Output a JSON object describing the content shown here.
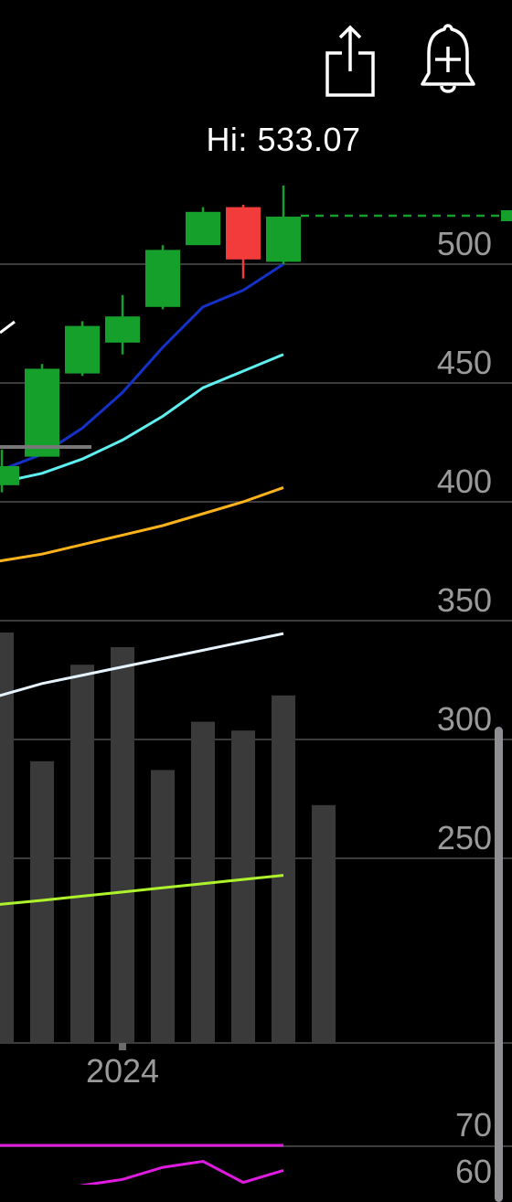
{
  "toolbar": {
    "share_icon": "share-icon",
    "alert_icon": "bell-plus-icon"
  },
  "hi_label": "Hi: 533.07",
  "colors": {
    "background": "#000000",
    "candle_up": "#14a02a",
    "candle_down": "#f23b3b",
    "ma_short": "#1431c8",
    "ma_mid": "#5ef0f0",
    "ma_long": "#ffb31a",
    "volume": "#3a3a3a",
    "volume_ma_fast": "#e6f4ff",
    "volume_ma_slow": "#aef22b",
    "rsi": "#e01be0",
    "grid": "#3c3c3c",
    "hi_marker": "#14a02a"
  },
  "chart_data": {
    "type": "candlestick",
    "y_axis": {
      "ticks": [
        "500",
        "450",
        "400",
        "350",
        "300",
        "250"
      ],
      "values": [
        500,
        450,
        400,
        350,
        300,
        250
      ],
      "range": [
        230,
        530
      ]
    },
    "x_axis": {
      "labels": [
        "2024"
      ],
      "label_index": [
        3
      ]
    },
    "candles": [
      {
        "open": 407,
        "close": 415,
        "high": 422,
        "low": 404
      },
      {
        "open": 419,
        "close": 456,
        "high": 458,
        "low": 419
      },
      {
        "open": 454,
        "close": 474,
        "high": 476,
        "low": 453
      },
      {
        "open": 467,
        "close": 478,
        "high": 487,
        "low": 462
      },
      {
        "open": 482,
        "close": 506,
        "high": 508,
        "low": 481
      },
      {
        "open": 508,
        "close": 522,
        "high": 524,
        "low": 518
      },
      {
        "open": 524,
        "close": 502,
        "high": 525,
        "low": 494
      },
      {
        "open": 501,
        "close": 520,
        "high": 533.07,
        "low": 500
      }
    ],
    "hi_value": 533.07,
    "ma_short": [
      413,
      420,
      431,
      446,
      465,
      482,
      489,
      500
    ],
    "ma_mid": [
      408,
      412,
      418,
      426,
      436,
      448,
      455,
      462
    ],
    "ma_long": [
      375,
      378,
      382,
      386,
      390,
      395,
      400,
      406
    ],
    "volume": [
      {
        "value": 0.64,
        "color": "dark"
      },
      {
        "value": 0.86,
        "color": "dark"
      },
      {
        "value": 0.9,
        "color": "dark"
      },
      {
        "value": 0.62,
        "color": "dark"
      },
      {
        "value": 0.73,
        "color": "dark"
      },
      {
        "value": 0.71,
        "color": "dark"
      },
      {
        "value": 0.79,
        "color": "dark"
      },
      {
        "value": 0.54,
        "color": "dark"
      }
    ],
    "volume_left_edge": 1.0,
    "volume_ma_fast": [
      0.83,
      0.86,
      0.88,
      0.9,
      0.92,
      0.94,
      0.96,
      0.98
    ],
    "volume_ma_slow": [
      0.33,
      0.34,
      0.35,
      0.36,
      0.37,
      0.38,
      0.39,
      0.4
    ],
    "rsi": {
      "ticks": [
        "70",
        "60"
      ],
      "values": [
        70,
        60
      ],
      "line": [
        53,
        55,
        57,
        59,
        63,
        65,
        58,
        62
      ],
      "reference": 70
    }
  }
}
